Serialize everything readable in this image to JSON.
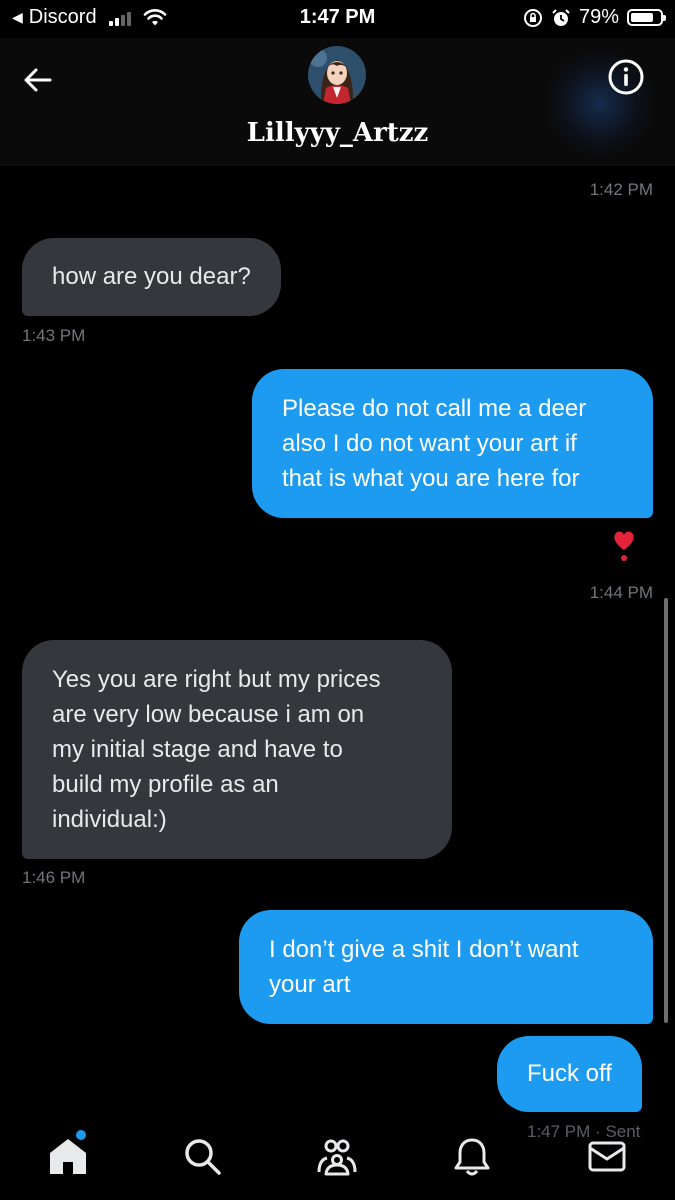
{
  "status_bar": {
    "back_app": "Discord",
    "time": "1:47 PM",
    "battery": "79%",
    "battery_level": 0.79,
    "icons": [
      "signal-icon",
      "wifi-icon",
      "orientation-lock-icon",
      "alarm-icon",
      "battery-icon"
    ]
  },
  "header": {
    "contact_name": "Lillyyy_Artzz",
    "icons": [
      "back-arrow-icon",
      "info-icon"
    ]
  },
  "conversation": {
    "messages": [
      {
        "id": "m0",
        "direction": "outgoing",
        "text": "",
        "time": "1:42 PM"
      },
      {
        "id": "m1",
        "direction": "incoming",
        "text": "how are you dear?",
        "time": "1:43 PM"
      },
      {
        "id": "m2",
        "direction": "outgoing",
        "lines": [
          "Please do not call me a deer",
          "also I do not want your art if",
          "that is what you are here for"
        ],
        "reaction": "heart",
        "time": "1:44 PM"
      },
      {
        "id": "m3",
        "direction": "incoming",
        "lines": [
          "Yes you are right but my prices",
          "are very low because i am on",
          "my initial stage and have to",
          "build my profile as an",
          "individual:)"
        ],
        "time": "1:46 PM"
      },
      {
        "id": "m4",
        "direction": "outgoing",
        "lines": [
          "I don’t give a shit I don’t want",
          "your art"
        ],
        "time": ""
      },
      {
        "id": "m5",
        "direction": "outgoing",
        "text": "Fuck off",
        "time": "1:47 PM",
        "status": "Sent"
      }
    ]
  },
  "bottom_nav": {
    "items": [
      "home-icon",
      "search-icon",
      "communities-icon",
      "notifications-icon",
      "messages-icon"
    ],
    "active": "home-icon",
    "accent": "#1d9bf0"
  },
  "colors": {
    "outgoing_bubble": "#1d9bf0",
    "incoming_bubble": "#34373b",
    "background": "#000000",
    "timestamp": "#71767b"
  }
}
